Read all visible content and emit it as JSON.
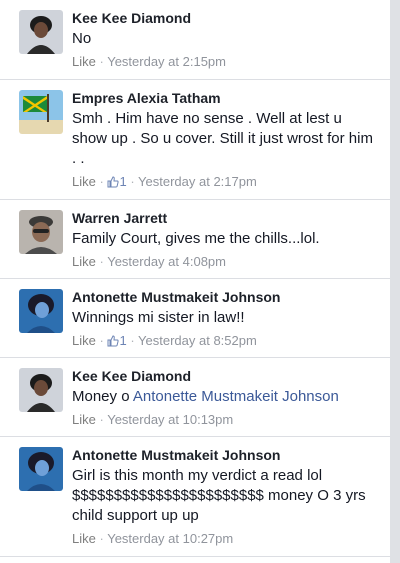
{
  "comments": [
    {
      "author": "Kee Kee Diamond",
      "text": "No",
      "mention": "",
      "like_label": "Like",
      "sep": "·",
      "likes": "",
      "time": "Yesterday at 2:15pm",
      "avatar_icon": "avatar-photo-woman"
    },
    {
      "author": "Empres Alexia Tatham",
      "text": "Smh . Him have no sense . Well at lest u show up . So u cover. Still it just wrost for him . .",
      "mention": "",
      "like_label": "Like",
      "sep": "·",
      "likes": "1",
      "time": "Yesterday at 2:17pm",
      "avatar_icon": "avatar-photo-beach-flag"
    },
    {
      "author": "Warren Jarrett",
      "text": "Family Court, gives me the chills...lol.",
      "mention": "",
      "like_label": "Like",
      "sep": "·",
      "likes": "",
      "time": "Yesterday at 4:08pm",
      "avatar_icon": "avatar-photo-man"
    },
    {
      "author": "Antonette Mustmakeit Johnson",
      "text": "Winnings mi sister in law!!",
      "mention": "",
      "like_label": "Like",
      "sep": "·",
      "likes": "1",
      "time": "Yesterday at 8:52pm",
      "avatar_icon": "avatar-photo-woman-blue"
    },
    {
      "author": "Kee Kee Diamond",
      "text": "Money o ",
      "mention": "Antonette Mustmakeit Johnson",
      "like_label": "Like",
      "sep": "·",
      "likes": "",
      "time": "Yesterday at 10:13pm",
      "avatar_icon": "avatar-photo-woman"
    },
    {
      "author": "Antonette Mustmakeit Johnson",
      "text": "Girl is this month my verdict a read lol $$$$$$$$$$$$$$$$$$$$$$$ money O 3 yrs child support up up",
      "mention": "",
      "like_label": "Like",
      "sep": "·",
      "likes": "",
      "time": "Yesterday at 10:27pm",
      "avatar_icon": "avatar-photo-woman-blue"
    }
  ],
  "colors": {
    "link": "#3b5998",
    "meta": "#90949c",
    "divider": "#dcdee3"
  }
}
